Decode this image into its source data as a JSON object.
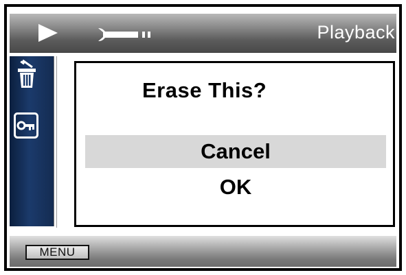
{
  "header": {
    "mode_label": "Playback",
    "play_icon": "play-icon",
    "settings_icon": "wrench-icon"
  },
  "sidebar": {
    "items": [
      {
        "icon": "trash-icon",
        "name": "erase"
      },
      {
        "icon": "key-icon",
        "name": "protect"
      }
    ]
  },
  "dialog": {
    "title": "Erase This?",
    "options": [
      {
        "label": "Cancel",
        "selected": true
      },
      {
        "label": "OK",
        "selected": false
      }
    ]
  },
  "footer": {
    "menu_label": "MENU"
  },
  "colors": {
    "selection": "#d8d8d8",
    "sidebar": "#1b3a6b",
    "bar": "#6a6a6a"
  }
}
